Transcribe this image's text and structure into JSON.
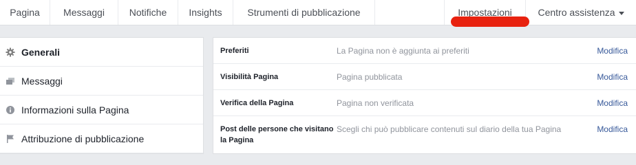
{
  "topnav": {
    "tabs": [
      "Pagina",
      "Messaggi",
      "Notifiche",
      "Insights",
      "Strumenti di pubblicazione"
    ],
    "settings": "Impostazioni",
    "help": "Centro assistenza"
  },
  "sidebar": {
    "items": [
      {
        "label": "Generali",
        "icon": "gear-icon",
        "active": true
      },
      {
        "label": "Messaggi",
        "icon": "messages-icon"
      },
      {
        "label": "Informazioni sulla Pagina",
        "icon": "info-icon"
      },
      {
        "label": "Attribuzione di pubblicazione",
        "icon": "flag-icon"
      }
    ]
  },
  "settings": {
    "edit_label": "Modifica",
    "rows": [
      {
        "label": "Preferiti",
        "value": "La Pagina non è aggiunta ai preferiti"
      },
      {
        "label": "Visibilità Pagina",
        "value": "Pagina pubblicata"
      },
      {
        "label": "Verifica della Pagina",
        "value": "Pagina non verificata"
      },
      {
        "label": "Post delle persone che visitano la Pagina",
        "value": "Scegli chi può pubblicare contenuti sul diario della tua Pagina"
      }
    ]
  },
  "colors": {
    "link": "#365899",
    "highlight_mark": "#e8220f",
    "muted_text": "#90949c"
  }
}
